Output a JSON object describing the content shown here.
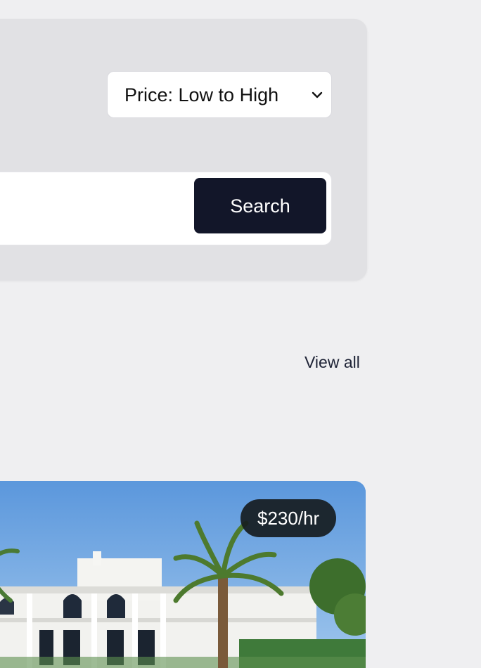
{
  "filters": {
    "sort": {
      "selected": "Price: Low to High"
    },
    "search": {
      "button_label": "Search"
    }
  },
  "section": {
    "view_all_label": "View all"
  },
  "listing": {
    "price": "$230/hr"
  },
  "colors": {
    "page_bg": "#efeff1",
    "panel_bg": "#e1e1e4",
    "search_button_bg": "#121629",
    "price_badge_bg": "#1c2226"
  },
  "icons": {
    "sort_dropdown": "chevron-down-icon"
  }
}
